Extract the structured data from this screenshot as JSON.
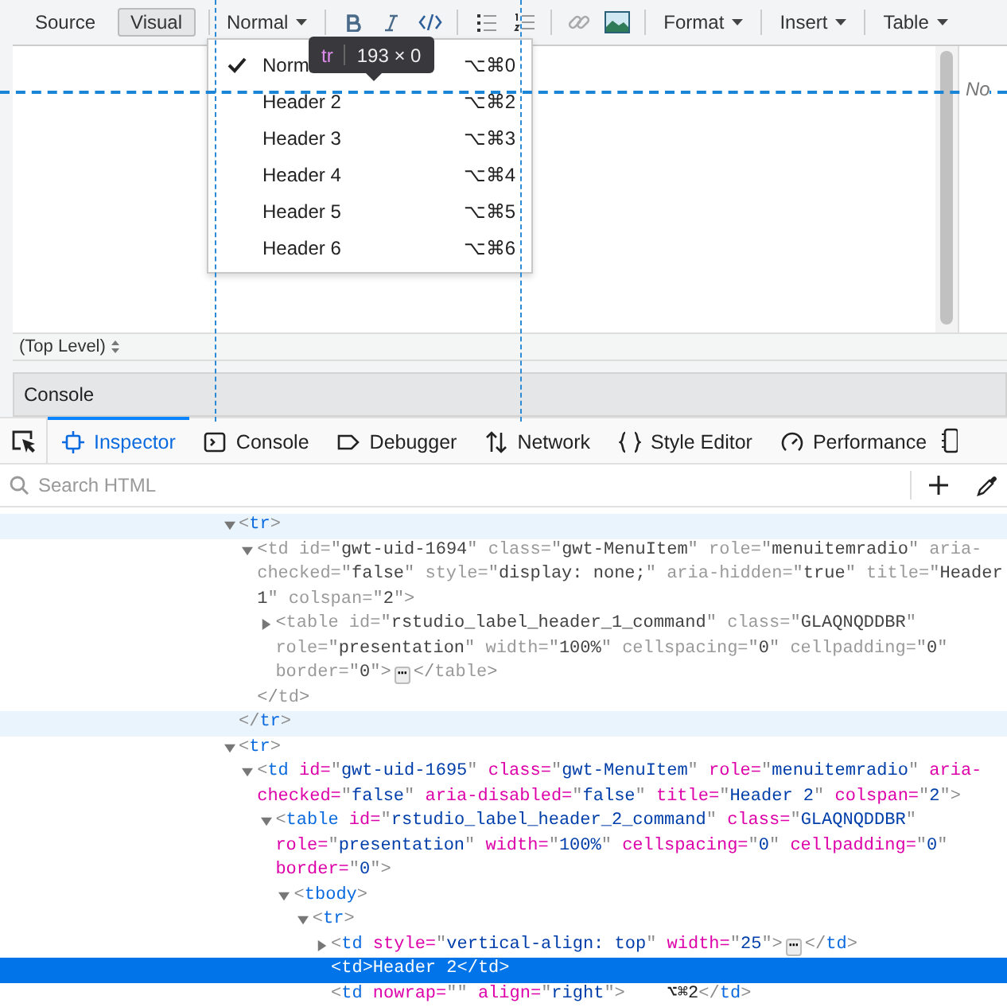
{
  "editor": {
    "toolbar": {
      "modes": [
        {
          "label": "Source",
          "selected": false
        },
        {
          "label": "Visual",
          "selected": true
        }
      ],
      "style_dropdown": "Normal",
      "menus": [
        "Format",
        "Insert",
        "Table"
      ]
    },
    "side_note": "No",
    "status": "(Top Level)",
    "console_bar": "Console"
  },
  "style_menu": {
    "items": [
      {
        "label": "Norm",
        "shortcut": "⌥⌘0",
        "selected": true
      },
      {
        "label": "Header 2",
        "shortcut": "⌥⌘2",
        "selected": false
      },
      {
        "label": "Header 3",
        "shortcut": "⌥⌘3",
        "selected": false
      },
      {
        "label": "Header 4",
        "shortcut": "⌥⌘4",
        "selected": false
      },
      {
        "label": "Header 5",
        "shortcut": "⌥⌘5",
        "selected": false
      },
      {
        "label": "Header 6",
        "shortcut": "⌥⌘6",
        "selected": false
      }
    ]
  },
  "highlight_tooltip": {
    "tag": "tr",
    "size": "193 × 0"
  },
  "devtools": {
    "tabs": [
      {
        "label": "Inspector",
        "kind": "inspector",
        "selected": true
      },
      {
        "label": "Console",
        "kind": "console",
        "selected": false
      },
      {
        "label": "Debugger",
        "kind": "debugger",
        "selected": false
      },
      {
        "label": "Network",
        "kind": "network",
        "selected": false
      },
      {
        "label": "Style Editor",
        "kind": "style",
        "selected": false
      },
      {
        "label": "Performance",
        "kind": "performance",
        "selected": false
      }
    ],
    "search": {
      "placeholder": "Search HTML"
    },
    "tree": [
      {
        "open": [
          "<tr>"
        ],
        "close": "</tr>",
        "expanded": true,
        "hovered": true,
        "dimmed": false,
        "selected": false,
        "children": [
          {
            "open": [
              "<td id=\"gwt-uid-1694\" class=\"gwt-MenuItem\" role=\"menuitemradio\" aria-",
              "checked=\"false\" style=\"display: none;\" aria-hidden=\"true\" title=\"Header",
              "1\" colspan=\"2\">"
            ],
            "close": "</td>",
            "expanded": true,
            "hovered": false,
            "dimmed": true,
            "selected": false,
            "children": [
              {
                "open": [
                  "<table id=\"rstudio_label_header_1_command\" class=\"GLAQNQDDBR\"",
                  "role=\"presentation\" width=\"100%\" cellspacing=\"0\" cellpadding=\"0\"",
                  "border=\"0\">"
                ],
                "collapsed_marker": "⋯",
                "close": "</table>",
                "expanded": false,
                "hovered": false,
                "dimmed": true,
                "selected": false
              }
            ]
          }
        ]
      },
      {
        "open": [
          "<tr>"
        ],
        "expanded": true,
        "hovered": false,
        "dimmed": false,
        "selected": false,
        "children": [
          {
            "open": [
              "<td id=\"gwt-uid-1695\" class=\"gwt-MenuItem\" role=\"menuitemradio\" aria-",
              "checked=\"false\" aria-disabled=\"false\" title=\"Header 2\" colspan=\"2\">"
            ],
            "expanded": true,
            "hovered": false,
            "dimmed": false,
            "selected": false,
            "children": [
              {
                "open": [
                  "<table id=\"rstudio_label_header_2_command\" class=\"GLAQNQDDBR\"",
                  "role=\"presentation\" width=\"100%\" cellspacing=\"0\" cellpadding=\"0\"",
                  "border=\"0\">"
                ],
                "expanded": true,
                "hovered": false,
                "dimmed": false,
                "selected": false,
                "children": [
                  {
                    "open": [
                      "<tbody>"
                    ],
                    "expanded": true,
                    "hovered": false,
                    "dimmed": false,
                    "selected": false,
                    "children": [
                      {
                        "open": [
                          "<tr>"
                        ],
                        "expanded": true,
                        "hovered": false,
                        "dimmed": false,
                        "selected": false,
                        "children": [
                          {
                            "open": [
                              "<td style=\"vertical-align: top\" width=\"25\">"
                            ],
                            "collapsed_marker": "⋯",
                            "close": "</td>",
                            "expanded": false,
                            "hovered": false,
                            "dimmed": false,
                            "selected": false
                          },
                          {
                            "open": [
                              "<td>Header 2</td>"
                            ],
                            "hovered": false,
                            "dimmed": false,
                            "selected": true
                          },
                          {
                            "open": [
                              "<td nowrap=\"\" align=\"right\">    ⌥⌘2</td>"
                            ],
                            "hovered": false,
                            "dimmed": false,
                            "selected": false
                          }
                        ]
                      }
                    ]
                  }
                ]
              }
            ]
          }
        ]
      }
    ]
  }
}
